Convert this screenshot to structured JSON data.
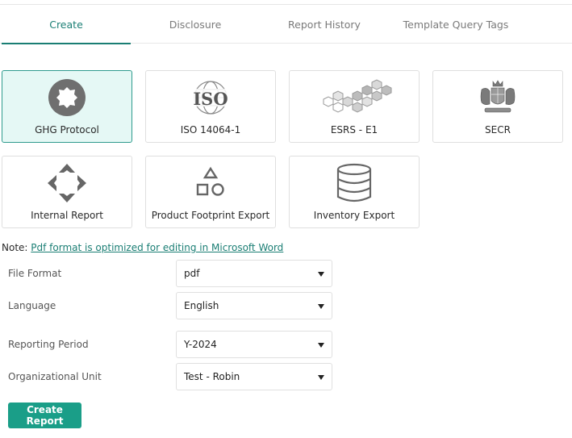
{
  "tabs": [
    {
      "label": "Create",
      "active": true
    },
    {
      "label": "Disclosure",
      "active": false
    },
    {
      "label": "Report History",
      "active": false
    },
    {
      "label": "Template Query Tags",
      "active": false
    }
  ],
  "report_types": [
    {
      "label": "GHG Protocol",
      "icon": "ghg-protocol-icon",
      "selected": true
    },
    {
      "label": "ISO 14064-1",
      "icon": "iso-logo-icon",
      "logo_text": "ISO",
      "selected": false
    },
    {
      "label": "ESRS - E1",
      "icon": "hexagons-icon",
      "selected": false
    },
    {
      "label": "SECR",
      "icon": "royal-crest-icon",
      "selected": false
    },
    {
      "label": "Internal Report",
      "icon": "diamond-arrows-icon",
      "selected": false
    },
    {
      "label": "Product Footprint Export",
      "icon": "shapes-icon",
      "selected": false
    },
    {
      "label": "Inventory Export",
      "icon": "database-icon",
      "selected": false
    }
  ],
  "note": {
    "prefix": "Note: ",
    "link": "Pdf format is optimized for editing in Microsoft Word"
  },
  "form": {
    "file_format": {
      "label": "File Format",
      "value": "pdf"
    },
    "language": {
      "label": "Language",
      "value": "English"
    },
    "reporting_period": {
      "label": "Reporting Period",
      "value": "Y-2024"
    },
    "org_unit": {
      "label": "Organizational Unit",
      "value": "Test - Robin"
    }
  },
  "create_button": "Create Report",
  "colors": {
    "accent": "#1a7e74",
    "button": "#1a9e88",
    "selected_card_bg": "#e5f8f5"
  }
}
